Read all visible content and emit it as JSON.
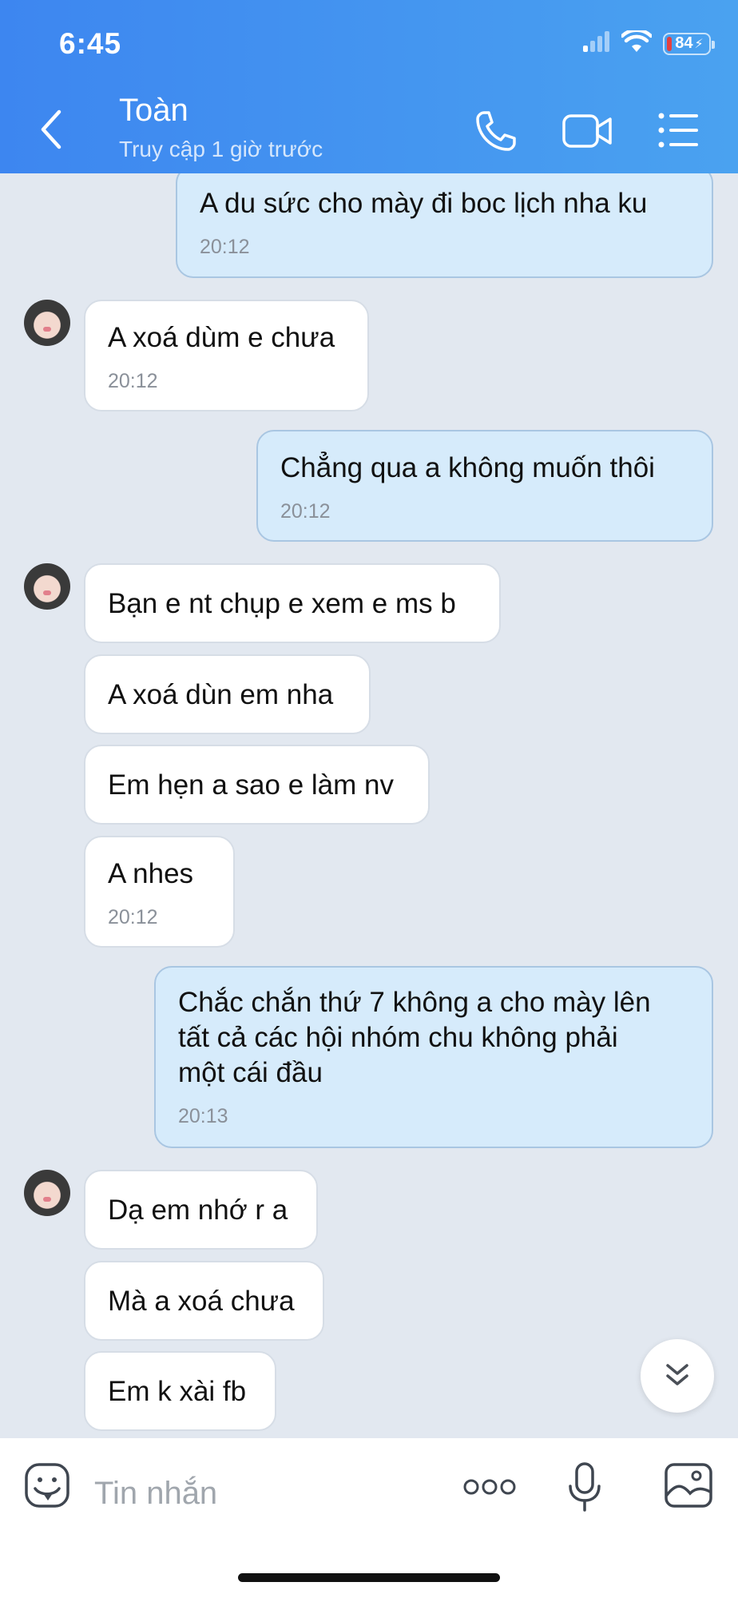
{
  "status_bar": {
    "time": "6:45",
    "battery": "84"
  },
  "header": {
    "contact_name": "Toàn",
    "contact_status": "Truy cập 1 giờ trước",
    "icons": [
      "back-icon",
      "phone-icon",
      "video-call-icon",
      "menu-list-icon"
    ]
  },
  "messages": [
    {
      "direction": "out",
      "text": "A du sức cho mày đi boc lịch nha ku",
      "time": "20:12"
    },
    {
      "direction": "in",
      "text": "A xoá dùm e chưa",
      "time": "20:12"
    },
    {
      "direction": "out",
      "text": "Chẳng qua a không muốn thôi",
      "time": "20:12"
    },
    {
      "direction": "in",
      "text": "Bạn e nt chụp e xem e ms b"
    },
    {
      "direction": "in",
      "text": "A xoá dùn em nha"
    },
    {
      "direction": "in",
      "text": "Em hẹn a sao e làm nv"
    },
    {
      "direction": "in",
      "text": "A nhes",
      "time": "20:12"
    },
    {
      "direction": "out",
      "lines": [
        "Chắc chắn thứ 7 không a cho mày lên",
        "tất cả các hội nhóm chu không phải",
        "một cái đầu"
      ],
      "time": "20:13"
    },
    {
      "direction": "in",
      "text": "Dạ em nhớ r a"
    },
    {
      "direction": "in",
      "text": "Mà a xoá chưa"
    },
    {
      "direction": "in",
      "text": "Em k xài fb"
    }
  ],
  "composer": {
    "placeholder": "Tin nhắn",
    "icons": [
      "emoji-icon",
      "more-options-icon",
      "microphone-icon",
      "image-icon"
    ]
  },
  "colors": {
    "header_start": "#3d86f0",
    "header_end": "#4aa2f0",
    "chat_background": "#e2e8f0",
    "outgoing_bubble": "#d6ebfb",
    "incoming_bubble": "#ffffff"
  }
}
